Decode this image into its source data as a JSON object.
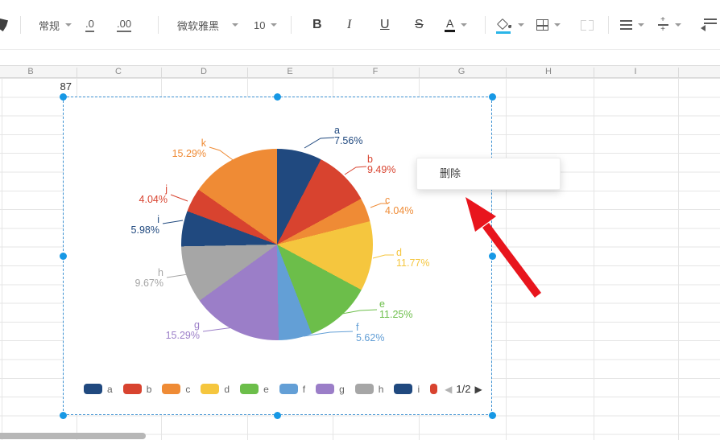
{
  "toolbar": {
    "number_format_label": "常规",
    "increase_decimal_label": ".0",
    "decrease_decimal_label": ".00",
    "font_name": "微软雅黑",
    "font_size": "10",
    "bold_label": "B",
    "italic_label": "I",
    "underline_label": "U",
    "strikethrough_label": "S",
    "font_color_label": "A",
    "fill_accent_color": "#2ab5e8",
    "font_color_bar": "#1a1a1a"
  },
  "spreadsheet": {
    "column_headers": [
      "B",
      "C",
      "D",
      "E",
      "F",
      "G",
      "H",
      "I"
    ],
    "cell_b1_value": "87"
  },
  "chart_data": {
    "type": "pie",
    "labels": [
      "a",
      "b",
      "c",
      "d",
      "e",
      "f",
      "g",
      "h",
      "i",
      "j",
      "k"
    ],
    "values": [
      7.56,
      9.49,
      4.04,
      11.77,
      11.25,
      5.62,
      15.29,
      9.67,
      5.98,
      4.04,
      15.29
    ],
    "unit": "%",
    "colors": [
      "#20497f",
      "#d8432f",
      "#ef8b35",
      "#f5c63e",
      "#6cbe4a",
      "#639fd6",
      "#9b7ec8",
      "#a6a6a6",
      "#20497f",
      "#d8432f",
      "#ef8b35"
    ],
    "slice_labels": [
      {
        "name": "a",
        "pct": "7.56%"
      },
      {
        "name": "b",
        "pct": "9.49%"
      },
      {
        "name": "c",
        "pct": "4.04%"
      },
      {
        "name": "d",
        "pct": "11.77%"
      },
      {
        "name": "e",
        "pct": "11.25%"
      },
      {
        "name": "f",
        "pct": "5.62%"
      },
      {
        "name": "g",
        "pct": "15.29%"
      },
      {
        "name": "h",
        "pct": "9.67%"
      },
      {
        "name": "i",
        "pct": "5.98%"
      },
      {
        "name": "j",
        "pct": "4.04%"
      },
      {
        "name": "k",
        "pct": "15.29%"
      }
    ],
    "legend": {
      "visible": [
        "a",
        "b",
        "c",
        "d",
        "e",
        "f",
        "g",
        "h",
        "i"
      ],
      "page_indicator": "1/2",
      "prev_icon": "◀",
      "next_icon": "▶"
    }
  },
  "context_menu": {
    "delete_label": "删除"
  },
  "annotation": {
    "arrow_color": "#e8151d"
  }
}
